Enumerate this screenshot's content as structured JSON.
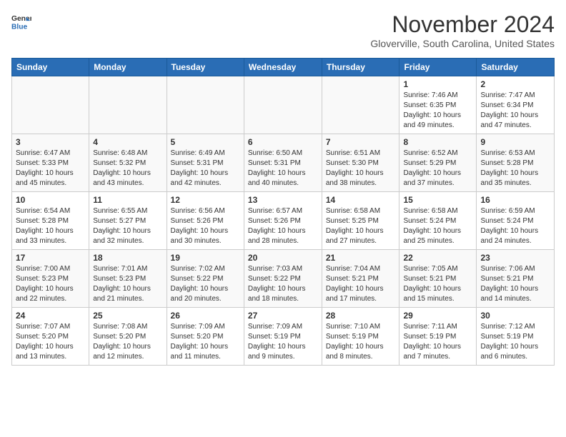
{
  "header": {
    "logo_general": "General",
    "logo_blue": "Blue",
    "month_title": "November 2024",
    "location": "Gloverville, South Carolina, United States"
  },
  "calendar": {
    "headers": [
      "Sunday",
      "Monday",
      "Tuesday",
      "Wednesday",
      "Thursday",
      "Friday",
      "Saturday"
    ],
    "weeks": [
      [
        {
          "day": "",
          "info": ""
        },
        {
          "day": "",
          "info": ""
        },
        {
          "day": "",
          "info": ""
        },
        {
          "day": "",
          "info": ""
        },
        {
          "day": "",
          "info": ""
        },
        {
          "day": "1",
          "info": "Sunrise: 7:46 AM\nSunset: 6:35 PM\nDaylight: 10 hours\nand 49 minutes."
        },
        {
          "day": "2",
          "info": "Sunrise: 7:47 AM\nSunset: 6:34 PM\nDaylight: 10 hours\nand 47 minutes."
        }
      ],
      [
        {
          "day": "3",
          "info": "Sunrise: 6:47 AM\nSunset: 5:33 PM\nDaylight: 10 hours\nand 45 minutes."
        },
        {
          "day": "4",
          "info": "Sunrise: 6:48 AM\nSunset: 5:32 PM\nDaylight: 10 hours\nand 43 minutes."
        },
        {
          "day": "5",
          "info": "Sunrise: 6:49 AM\nSunset: 5:31 PM\nDaylight: 10 hours\nand 42 minutes."
        },
        {
          "day": "6",
          "info": "Sunrise: 6:50 AM\nSunset: 5:31 PM\nDaylight: 10 hours\nand 40 minutes."
        },
        {
          "day": "7",
          "info": "Sunrise: 6:51 AM\nSunset: 5:30 PM\nDaylight: 10 hours\nand 38 minutes."
        },
        {
          "day": "8",
          "info": "Sunrise: 6:52 AM\nSunset: 5:29 PM\nDaylight: 10 hours\nand 37 minutes."
        },
        {
          "day": "9",
          "info": "Sunrise: 6:53 AM\nSunset: 5:28 PM\nDaylight: 10 hours\nand 35 minutes."
        }
      ],
      [
        {
          "day": "10",
          "info": "Sunrise: 6:54 AM\nSunset: 5:28 PM\nDaylight: 10 hours\nand 33 minutes."
        },
        {
          "day": "11",
          "info": "Sunrise: 6:55 AM\nSunset: 5:27 PM\nDaylight: 10 hours\nand 32 minutes."
        },
        {
          "day": "12",
          "info": "Sunrise: 6:56 AM\nSunset: 5:26 PM\nDaylight: 10 hours\nand 30 minutes."
        },
        {
          "day": "13",
          "info": "Sunrise: 6:57 AM\nSunset: 5:26 PM\nDaylight: 10 hours\nand 28 minutes."
        },
        {
          "day": "14",
          "info": "Sunrise: 6:58 AM\nSunset: 5:25 PM\nDaylight: 10 hours\nand 27 minutes."
        },
        {
          "day": "15",
          "info": "Sunrise: 6:58 AM\nSunset: 5:24 PM\nDaylight: 10 hours\nand 25 minutes."
        },
        {
          "day": "16",
          "info": "Sunrise: 6:59 AM\nSunset: 5:24 PM\nDaylight: 10 hours\nand 24 minutes."
        }
      ],
      [
        {
          "day": "17",
          "info": "Sunrise: 7:00 AM\nSunset: 5:23 PM\nDaylight: 10 hours\nand 22 minutes."
        },
        {
          "day": "18",
          "info": "Sunrise: 7:01 AM\nSunset: 5:23 PM\nDaylight: 10 hours\nand 21 minutes."
        },
        {
          "day": "19",
          "info": "Sunrise: 7:02 AM\nSunset: 5:22 PM\nDaylight: 10 hours\nand 20 minutes."
        },
        {
          "day": "20",
          "info": "Sunrise: 7:03 AM\nSunset: 5:22 PM\nDaylight: 10 hours\nand 18 minutes."
        },
        {
          "day": "21",
          "info": "Sunrise: 7:04 AM\nSunset: 5:21 PM\nDaylight: 10 hours\nand 17 minutes."
        },
        {
          "day": "22",
          "info": "Sunrise: 7:05 AM\nSunset: 5:21 PM\nDaylight: 10 hours\nand 15 minutes."
        },
        {
          "day": "23",
          "info": "Sunrise: 7:06 AM\nSunset: 5:21 PM\nDaylight: 10 hours\nand 14 minutes."
        }
      ],
      [
        {
          "day": "24",
          "info": "Sunrise: 7:07 AM\nSunset: 5:20 PM\nDaylight: 10 hours\nand 13 minutes."
        },
        {
          "day": "25",
          "info": "Sunrise: 7:08 AM\nSunset: 5:20 PM\nDaylight: 10 hours\nand 12 minutes."
        },
        {
          "day": "26",
          "info": "Sunrise: 7:09 AM\nSunset: 5:20 PM\nDaylight: 10 hours\nand 11 minutes."
        },
        {
          "day": "27",
          "info": "Sunrise: 7:09 AM\nSunset: 5:19 PM\nDaylight: 10 hours\nand 9 minutes."
        },
        {
          "day": "28",
          "info": "Sunrise: 7:10 AM\nSunset: 5:19 PM\nDaylight: 10 hours\nand 8 minutes."
        },
        {
          "day": "29",
          "info": "Sunrise: 7:11 AM\nSunset: 5:19 PM\nDaylight: 10 hours\nand 7 minutes."
        },
        {
          "day": "30",
          "info": "Sunrise: 7:12 AM\nSunset: 5:19 PM\nDaylight: 10 hours\nand 6 minutes."
        }
      ]
    ]
  }
}
